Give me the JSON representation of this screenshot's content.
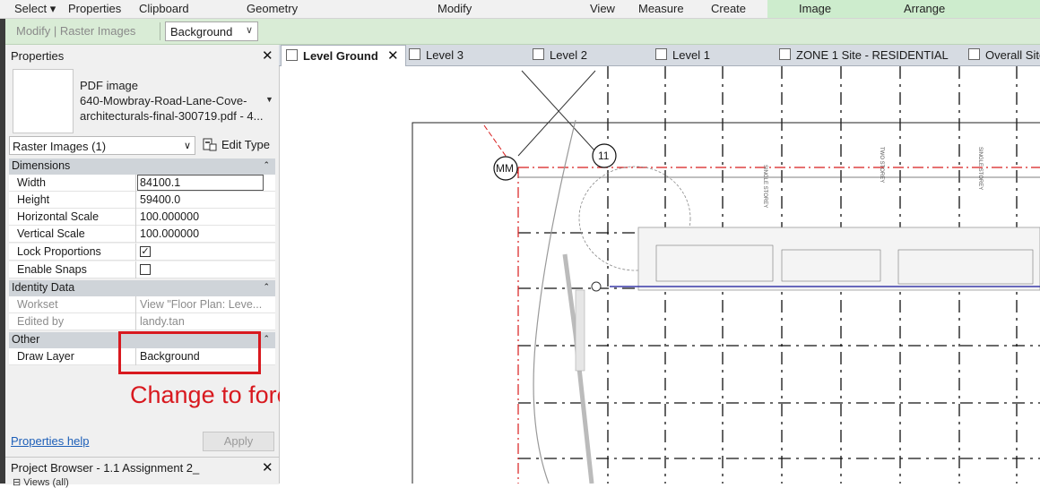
{
  "ribbon": {
    "tabs": [
      "Select ▾",
      "Properties",
      "Clipboard",
      "Geometry",
      "Modify",
      "View",
      "Measure",
      "Create",
      "Image",
      "Arrange"
    ]
  },
  "options_bar": {
    "context_label": "Modify | Raster Images",
    "draw_layer_value": "Background"
  },
  "properties": {
    "title": "Properties",
    "type_line1": "PDF image",
    "type_line2": "640-Mowbray-Road-Lane-Cove-",
    "type_line3": "architecturals-final-300719.pdf - 4...",
    "filter_label": "Raster Images (1)",
    "edit_type_label": "Edit Type",
    "groups": {
      "dimensions": "Dimensions",
      "identity": "Identity Data",
      "other": "Other"
    },
    "rows": {
      "width_k": "Width",
      "width_v": "84100.1",
      "height_k": "Height",
      "height_v": "59400.0",
      "hscale_k": "Horizontal Scale",
      "hscale_v": "100.000000",
      "vscale_k": "Vertical Scale",
      "vscale_v": "100.000000",
      "lock_k": "Lock Proportions",
      "snaps_k": "Enable Snaps",
      "workset_k": "Workset",
      "workset_v": "View \"Floor Plan: Leve...",
      "editedby_k": "Edited by",
      "editedby_v": "landy.tan",
      "drawlayer_k": "Draw Layer",
      "drawlayer_v": "Background"
    },
    "lock_checked": true,
    "snaps_checked": false,
    "help_link": "Properties help",
    "apply_label": "Apply",
    "annotation": "Change to foreground"
  },
  "project_browser": {
    "title": "Project Browser - 1.1 Assignment 2_",
    "first_item": "Views (all)"
  },
  "view_tabs": [
    "Level Ground",
    "Level 3",
    "Level 2",
    "Level 1",
    "ZONE 1 Site - RESIDENTIAL",
    "Overall Site"
  ],
  "canvas": {
    "grid_bubble_1": "MM",
    "grid_bubble_2": "11"
  },
  "colors": {
    "accent_green": "#d9ecd6",
    "annotation_red": "#d8191f",
    "link_blue": "#1d5fb8"
  },
  "icons": [
    "close-icon",
    "chevron-down-icon",
    "collapse-icon",
    "edit-type-icon",
    "view-tab-icon",
    "checkbox-icon"
  ]
}
